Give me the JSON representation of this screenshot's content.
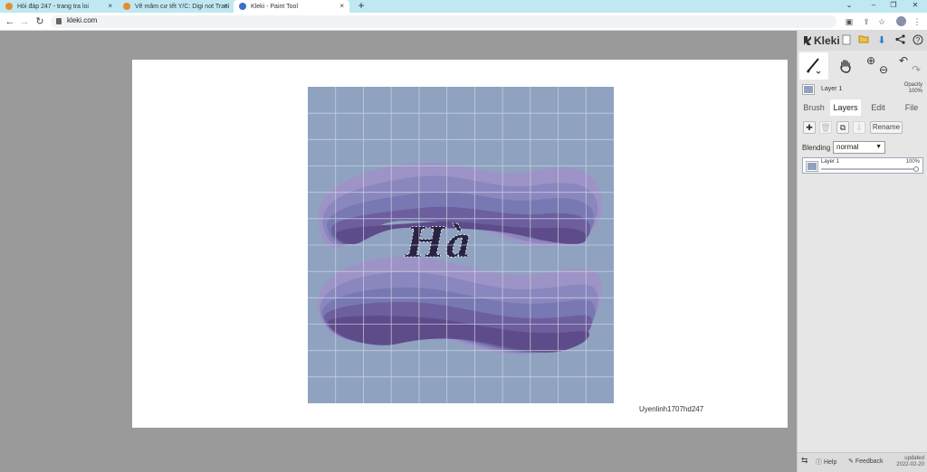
{
  "browser": {
    "tabs": [
      {
        "title": "Hỏi đáp 247 - trang tra loi",
        "color": "#e88b2e"
      },
      {
        "title": "Vẽ mâm cư tết Y/C: Digi not Traci",
        "color": "#e88b2e"
      },
      {
        "title": "Kleki - Paint Tool",
        "color": "#3a6fc4"
      }
    ],
    "close_glyph": "×",
    "new_tab_glyph": "+",
    "url": "kleki.com",
    "nav": {
      "back": "←",
      "forward": "→",
      "reload": "↻"
    },
    "window": {
      "chevron": "⌄",
      "minimize": "–",
      "restore": "❐",
      "close": "✕"
    }
  },
  "canvas": {
    "signature": "Uyenlinh1707hd247",
    "artwork_text": "Hà",
    "colors": {
      "background": "#8fa2c0",
      "grid": "#cdd6e5",
      "ink": "#2a2444"
    }
  },
  "panel": {
    "logo": "Kleki",
    "top_icons": [
      "new-icon",
      "open-icon",
      "download-icon",
      "share-icon",
      "help-icon"
    ],
    "tools": {
      "brush": "brush-icon",
      "hand": "hand-icon",
      "zoom_in": "⊕",
      "zoom_out": "⊖",
      "undo": "↶",
      "redo": "↷"
    },
    "current_layer": "Layer 1",
    "opacity_label": "Opacity",
    "opacity_value": "100%",
    "tabs": [
      "Brush",
      "Layers",
      "Edit",
      "File"
    ],
    "active_tab": "Layers",
    "layer_buttons": {
      "add": "✚",
      "delete": "🗑",
      "duplicate": "⧉",
      "merge": "⇩",
      "rename": "Rename"
    },
    "blending_label": "Blending",
    "blending_value": "normal",
    "layers": [
      {
        "name": "Layer 1",
        "opacity": "100%",
        "opacity_fraction": 1.0
      }
    ],
    "footer": {
      "swap": "⇆",
      "help": "Help",
      "feedback": "Feedback",
      "updated_label": "updated",
      "updated_date": "2022-02-20"
    }
  }
}
